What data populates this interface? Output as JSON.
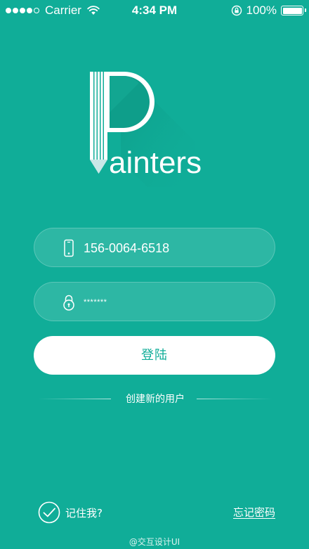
{
  "status_bar": {
    "carrier": "Carrier",
    "time": "4:34 PM",
    "battery": "100%"
  },
  "logo": {
    "text": "ainters",
    "initial": "P"
  },
  "login_form": {
    "phone_value": "156-0064-6518",
    "password_value": "*******",
    "login_label": "登陆",
    "create_user_label": "创建新的用户"
  },
  "footer": {
    "remember_label": "记住我?",
    "forgot_label": "忘记密码",
    "watermark": "@交互设计UI"
  },
  "colors": {
    "background": "#10ad98",
    "primary_text": "#ffffff",
    "button_text": "#10ad98"
  }
}
